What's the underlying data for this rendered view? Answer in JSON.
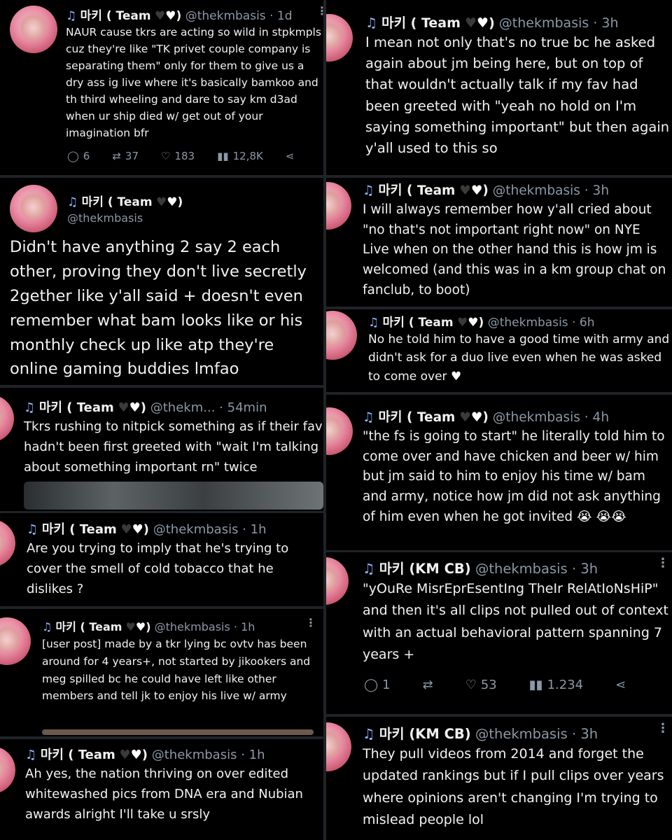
{
  "tweets": [
    {
      "name": "마키 ( Team",
      "handle": "@thekmbasis",
      "time": "1d",
      "text": "NAUR cause tkrs are acting so wild in stpkmpls cuz they're like \"TK privet couple company is separating them\" only for them to give us a dry ass ig live where it's basically bamkoo and th third wheeling and dare to say km d3ad when ur ship died w/ get out of your imagination bfr",
      "replies": "6",
      "retweets": "37",
      "likes": "183",
      "views": "12,8K"
    },
    {
      "name": "마키 ( Team",
      "handle": "@thekmbasis",
      "text": "Didn't have anything 2 say 2 each other, proving they don't live secretly 2gether like y'all said + doesn't even remember what bam looks like or his monthly check up like atp they're online gaming buddies lmfao"
    },
    {
      "name": "마키 ( Team",
      "handle": "@thekm...",
      "time": "54min",
      "text": "Tkrs rushing to nitpick something as if their fav hadn't been first greeted with \"wait I'm talking about something important rn\" twice"
    },
    {
      "name": "마키 ( Team",
      "handle": "@thekmbasis",
      "time": "1h",
      "text": "Are you trying to imply that he's trying to cover the smell of cold tobacco that he dislikes ?"
    },
    {
      "name": "마키 ( Team",
      "handle": "@thekmbasis",
      "time": "1h",
      "text": "[user post] made by a tkr lying bc ovtv has been around for 4 years+, not started by jikookers and meg spilled bc he could have left like other members and tell jk to enjoy his live w/ army"
    },
    {
      "name": "마키 ( Team",
      "handle": "@thekmbasis",
      "time": "1h",
      "text": "Ah yes, the nation thriving on over edited whitewashed pics from DNA era and Nubian awards alright I'll take u srsly"
    },
    {
      "name": "마키 ( Team",
      "handle": "@thekmbasis",
      "time": "3h",
      "text": "I mean not only that's no true bc he asked again about jm being here, but on top of that wouldn't actually talk if my fav had been greeted with \"yeah no hold on I'm saying something important\" but then again y'all used to this so"
    },
    {
      "name": "마키 ( Team",
      "handle": "@thekmbasis",
      "time": "3h",
      "text": "I will always remember how y'all cried about \"no that's not important right now\" on NYE Live when on the other hand this is how jm is welcomed (and this was in a km group chat on fanclub, to boot)"
    },
    {
      "name": "마키 ( Team",
      "handle": "@thekmbasis",
      "time": "6h",
      "text": "No he told him to have a good time with army and didn't ask for a duo live even when he was asked to come over"
    },
    {
      "name": "마키 ( Team",
      "handle": "@thekmbasis",
      "time": "4h",
      "text": "\"the fs is going to start\" he literally told him to come over and have chicken and beer w/ him but jm said to him to enjoy his time w/ bam and army, notice how jm did not ask anything of him even when he got invited",
      "emoji": "😭 😭😭"
    },
    {
      "name": "마키 (KM CB)",
      "handle": "@thekmbasis",
      "time": "3h",
      "text": "\"yOuRe MisrEprEsentIng TheIr RelAtIoNsHiP\" and then it's all clips not pulled out of context with an actual behavioral pattern spanning 7 years +",
      "replies": "1",
      "likes": "53",
      "views": "1.234"
    },
    {
      "name": "마키 (KM CB)",
      "handle": "@thekmbasis",
      "time": "3h",
      "text": "They pull videos from 2014 and forget the updated rankings but if I pull clips over years where opinions aren't changing I'm trying to mislead people lol"
    }
  ],
  "colors": {
    "accent_note": "#8fb6ff",
    "muted": "#8b98a5",
    "text": "#f2f2f2",
    "bg": "#000000"
  },
  "icons": [
    "music-note-icon",
    "black-heart-icon",
    "white-heart-icon",
    "reply-icon",
    "retweet-icon",
    "like-icon",
    "views-icon",
    "share-icon",
    "more-icon"
  ]
}
